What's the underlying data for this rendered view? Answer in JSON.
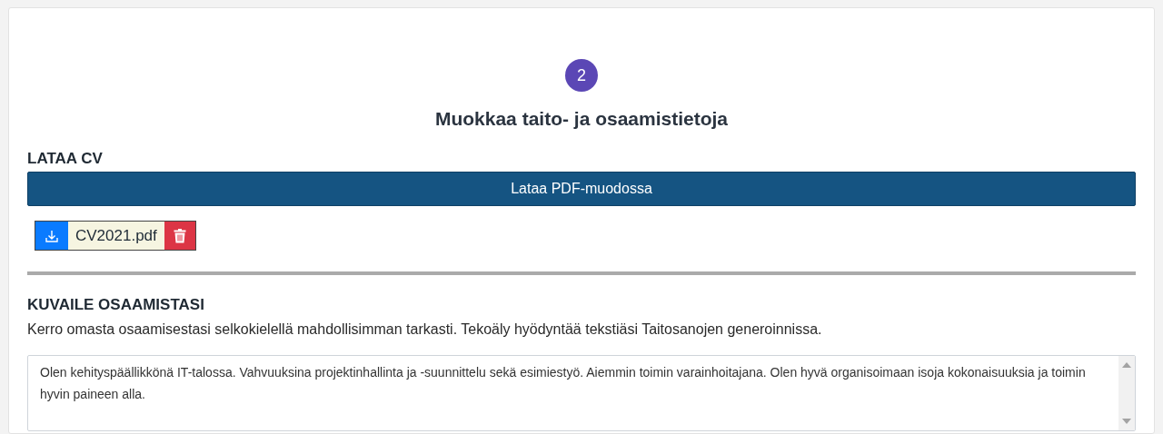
{
  "step": {
    "number": "2",
    "title": "Muokkaa taito- ja osaamistietoja"
  },
  "cv": {
    "heading": "LATAA CV",
    "download_button": "Lataa PDF-muodossa",
    "files": [
      {
        "name": "CV2021.pdf"
      }
    ]
  },
  "describe": {
    "heading": "KUVAILE OSAAMISTASI",
    "instructions": "Kerro omasta osaamisestasi selkokielellä mahdollisimman tarkasti. Tekoäly hyödyntää tekstiäsi Taitosanojen generoinnissa.",
    "value": "Olen kehityspäällikkönä IT-talossa. Vahvuuksina projektinhallinta ja -suunnittelu sekä esimiestyö. Aiemmin toimin varainhoitajana. Olen hyvä organisoimaan isoja kokonaisuuksia ja toimin hyvin paineen alla."
  }
}
